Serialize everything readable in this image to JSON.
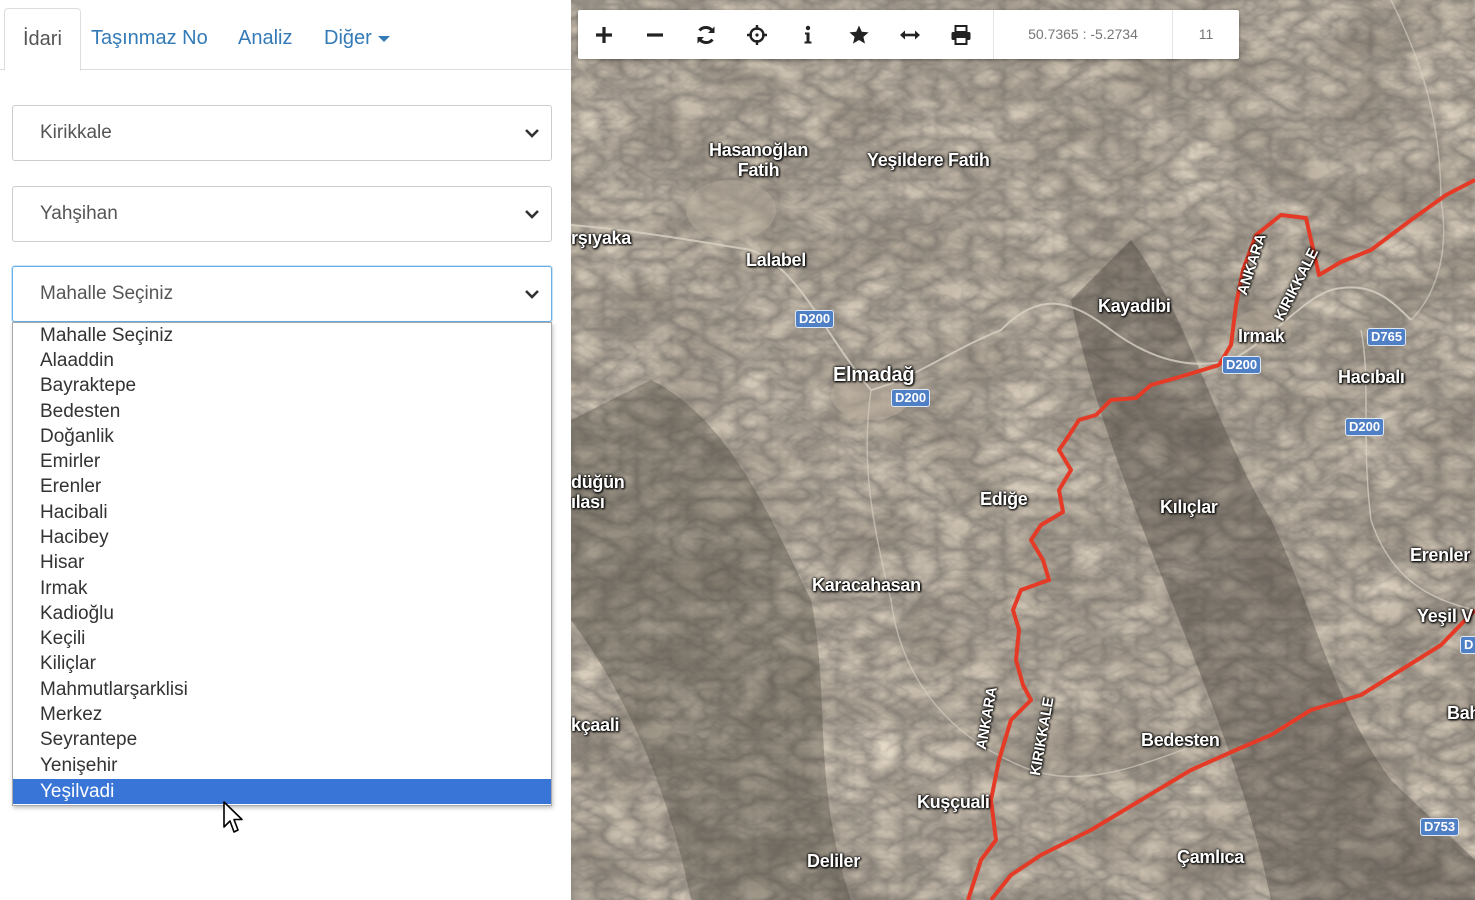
{
  "tabs": [
    {
      "label": "İdari",
      "active": true
    },
    {
      "label": "Taşınmaz No",
      "active": false
    },
    {
      "label": "Analiz",
      "active": false
    },
    {
      "label": "Diğer",
      "active": false
    }
  ],
  "selects": {
    "province": {
      "value": "Kirikkale"
    },
    "district": {
      "value": "Yahşihan"
    },
    "neighborhood": {
      "value": "Mahalle Seçiniz"
    }
  },
  "neighborhood_options": [
    "Mahalle Seçiniz",
    "Alaaddin",
    "Bayraktepe",
    "Bedesten",
    "Doğanlik",
    "Emirler",
    "Erenler",
    "Hacibali",
    "Hacibey",
    "Hisar",
    "Irmak",
    "Kadioğlu",
    "Keçili",
    "Kiliçlar",
    "Mahmutlarşarklisi",
    "Merkez",
    "Seyrantepe",
    "Yenişehir",
    "Yeşilvadi"
  ],
  "highlighted_option": "Yeşilvadi",
  "toolbar": {
    "buttons": [
      "plus-icon",
      "minus-icon",
      "refresh-icon",
      "crosshair-icon",
      "info-icon",
      "star-icon",
      "measure-icon",
      "print-icon"
    ],
    "coordinates": "50.7365 : -5.2734",
    "zoom_level": "11"
  },
  "map": {
    "labels": {
      "hasanoglan": "Hasanoğlan\nFatih",
      "yesildere": "Yeşildere Fatih",
      "arsiyaka": "rşıyaka",
      "lalabel": "Lalabel",
      "kayadibi": "Kayadibi",
      "irmak": "Irmak",
      "hacibali": "Hacıbalı",
      "elmadag": "Elmadağ",
      "edige": "Ediğe",
      "kiliclar": "Kılıçlar",
      "dugun": "düğün\nılası",
      "erenler": "Erenler",
      "karacahasan": "Karacahasan",
      "yesilv": "Yeşil V",
      "akcaali": "kçaali",
      "bedesten": "Bedesten",
      "bahs": "Bahş",
      "kuscuali": "Kuşçuali",
      "deliler": "Deliler",
      "camlica": "Çamlıca",
      "ankara_n": "ANKARA",
      "kirikkale_n": "KIRIKKALE",
      "ankara_s": "ANKARA",
      "kirikkale_s": "KIRIKKALE"
    },
    "roads": {
      "d200_a": "D200",
      "d200_b": "D200",
      "d200_c": "D200",
      "d200_d": "D200",
      "d765": "D765",
      "d753": "D753",
      "d_edge": "D"
    },
    "boundary_color": "#e53a26"
  }
}
